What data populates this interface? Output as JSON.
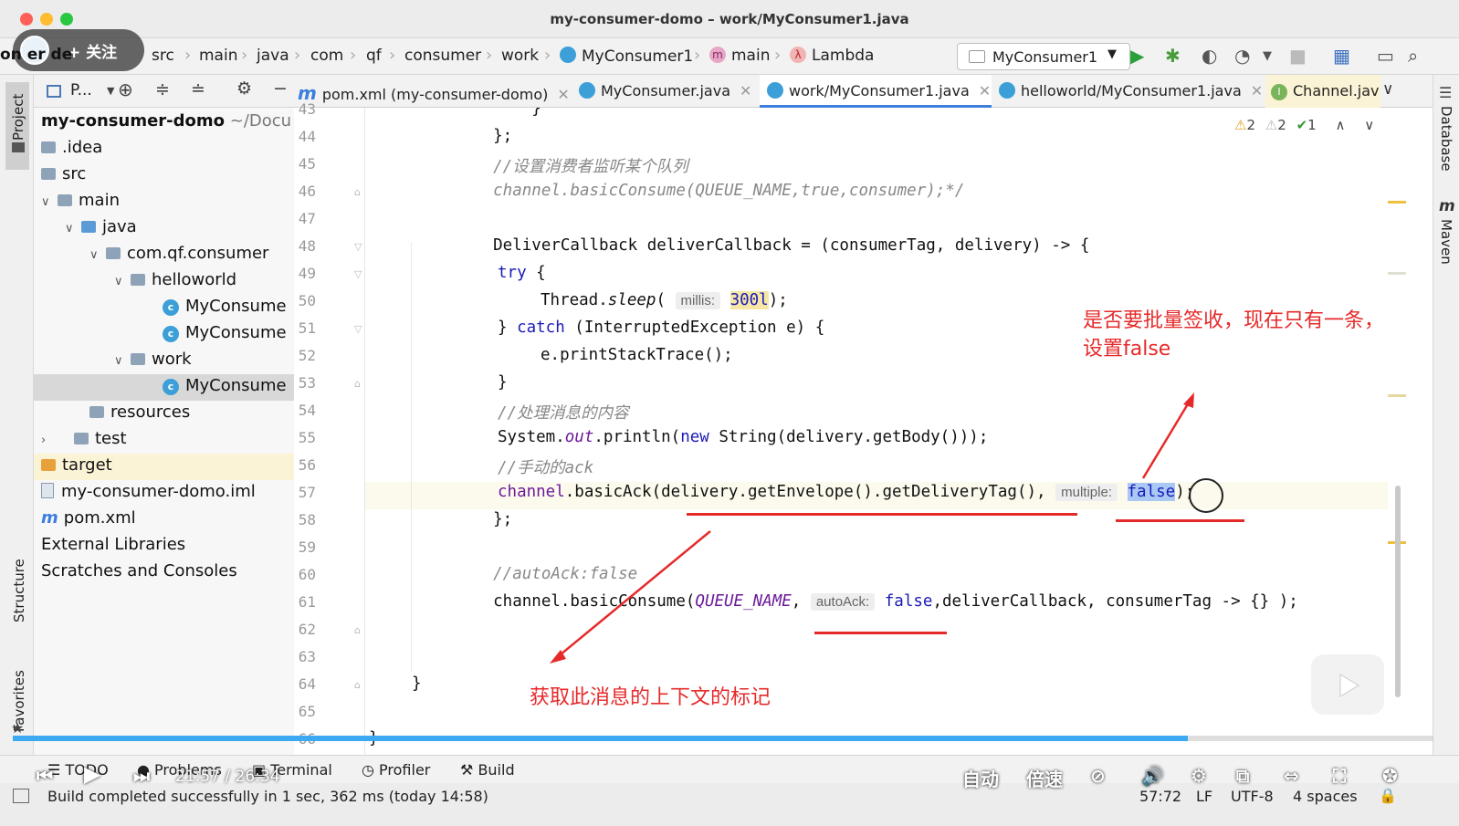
{
  "window": {
    "title": "my-consumer-domo – work/MyConsumer1.java"
  },
  "breadcrumb": [
    "src",
    "main",
    "java",
    "com",
    "qf",
    "consumer",
    "work",
    "MyConsumer1",
    "main",
    "Lambda"
  ],
  "run_config": "MyConsumer1",
  "follow_overlay": {
    "text": "+ 关注",
    "partial_label": "on  er de"
  },
  "project_panel": {
    "title": "P...",
    "tree": [
      {
        "label": "my-consumer-domo",
        "suffix": "~/Docu",
        "level": 0,
        "kind": "module"
      },
      {
        "label": ".idea",
        "level": 0,
        "kind": "folder"
      },
      {
        "label": "src",
        "level": 0,
        "kind": "folder"
      },
      {
        "label": "main",
        "level": 1,
        "kind": "folder",
        "arrow": "v"
      },
      {
        "label": "java",
        "level": 2,
        "kind": "srcfolder",
        "arrow": "v"
      },
      {
        "label": "com.qf.consumer",
        "level": 3,
        "kind": "package",
        "arrow": "v"
      },
      {
        "label": "helloworld",
        "level": 4,
        "kind": "package",
        "arrow": "v"
      },
      {
        "label": "MyConsume",
        "level": 5,
        "kind": "class"
      },
      {
        "label": "MyConsume",
        "level": 5,
        "kind": "class"
      },
      {
        "label": "work",
        "level": 4,
        "kind": "package",
        "arrow": "v"
      },
      {
        "label": "MyConsume",
        "level": 5,
        "kind": "class",
        "selected": true
      },
      {
        "label": "resources",
        "level": 3,
        "kind": "folder"
      },
      {
        "label": "test",
        "level": 1,
        "kind": "folder",
        "arrow": ">"
      },
      {
        "label": "target",
        "level": 0,
        "kind": "orangefolder",
        "highlight": true
      },
      {
        "label": "my-consumer-domo.iml",
        "level": 0,
        "kind": "file"
      },
      {
        "label": "pom.xml",
        "level": 0,
        "kind": "maven"
      },
      {
        "label": "External Libraries",
        "level": 0,
        "kind": "none"
      },
      {
        "label": "Scratches and Consoles",
        "level": 0,
        "kind": "none"
      }
    ]
  },
  "tabs": [
    {
      "label": "pom.xml (my-consumer-domo)",
      "icon": "m"
    },
    {
      "label": "MyConsumer.java",
      "icon": "c"
    },
    {
      "label": "work/MyConsumer1.java",
      "icon": "c",
      "active": true
    },
    {
      "label": "helloworld/MyConsumer1.java",
      "icon": "c"
    },
    {
      "label": "Channel.jav",
      "icon": "i"
    }
  ],
  "inspections": {
    "warn1": "2",
    "warn2": "2",
    "ok": "1"
  },
  "line_numbers": [
    "43",
    "44",
    "45",
    "46",
    "47",
    "48",
    "49",
    "50",
    "51",
    "52",
    "53",
    "54",
    "55",
    "56",
    "57",
    "58",
    "59",
    "60",
    "61",
    "62",
    "63",
    "64",
    "65",
    "66"
  ],
  "code": {
    "l43": "        }",
    "l44": "    };",
    "l45": "    //设置消费者监听某个队列",
    "l46": "    channel.basicConsume(QUEUE_NAME,true,consumer);*/",
    "l48": "    DeliverCallback deliverCallback = (consumerTag, delivery) -> {",
    "l49_kw": "try",
    "l49_rest": " {",
    "l50_a": "Thread.",
    "l50_b": "sleep",
    "l50_c": "( ",
    "l50_hint": "millis:",
    "l50_val": "300l",
    "l50_end": ");",
    "l51_a": "} ",
    "l51_kw": "catch",
    "l51_rest": " (InterruptedException e) {",
    "l52": "e.printStackTrace();",
    "l53": "}",
    "l54": "//处理消息的内容",
    "l55_a": "System.",
    "l55_out": "out",
    "l55_b": ".println(",
    "l55_kw": "new",
    "l55_c": " String(delivery.getBody()));",
    "l56": "//手动的ack",
    "l57_a": "channel",
    "l57_b": ".basicAck(delivery.getEnvelope().getDeliveryTag(), ",
    "l57_hint": "multiple:",
    "l57_val": "false",
    "l57_end": ");",
    "l58": "    };",
    "l60": "    //autoAck:false",
    "l61_a": "    channel.basicConsume(",
    "l61_q": "QUEUE_NAME",
    "l61_b": ", ",
    "l61_hint": "autoAck:",
    "l61_val": "false",
    "l61_c": ",deliverCallback, consumerTag -> {} );",
    "l64": "}",
    "l66": "}"
  },
  "annotations": {
    "a1_line1": "是否要批量签收，现在只有一条，",
    "a1_line2": "设置false",
    "a2": "获取此消息的上下文的标记",
    "color": "#e62a2a"
  },
  "side_tabs": {
    "project": "Project",
    "structure": "Structure",
    "favorites": "Favorites",
    "database": "Database",
    "maven": "Maven"
  },
  "tool_windows": [
    "TODO",
    "Problems",
    "Terminal",
    "Profiler",
    "Build"
  ],
  "video": {
    "time": "21:57 / 26:34",
    "auto": "自动",
    "speed": "倍速",
    "progress": 0.827
  },
  "status": {
    "message": "Build completed successfully in 1 sec, 362 ms (today 14:58)",
    "position": "57:72",
    "line_sep": "LF",
    "encoding": "UTF-8",
    "indent": "4 spaces"
  }
}
